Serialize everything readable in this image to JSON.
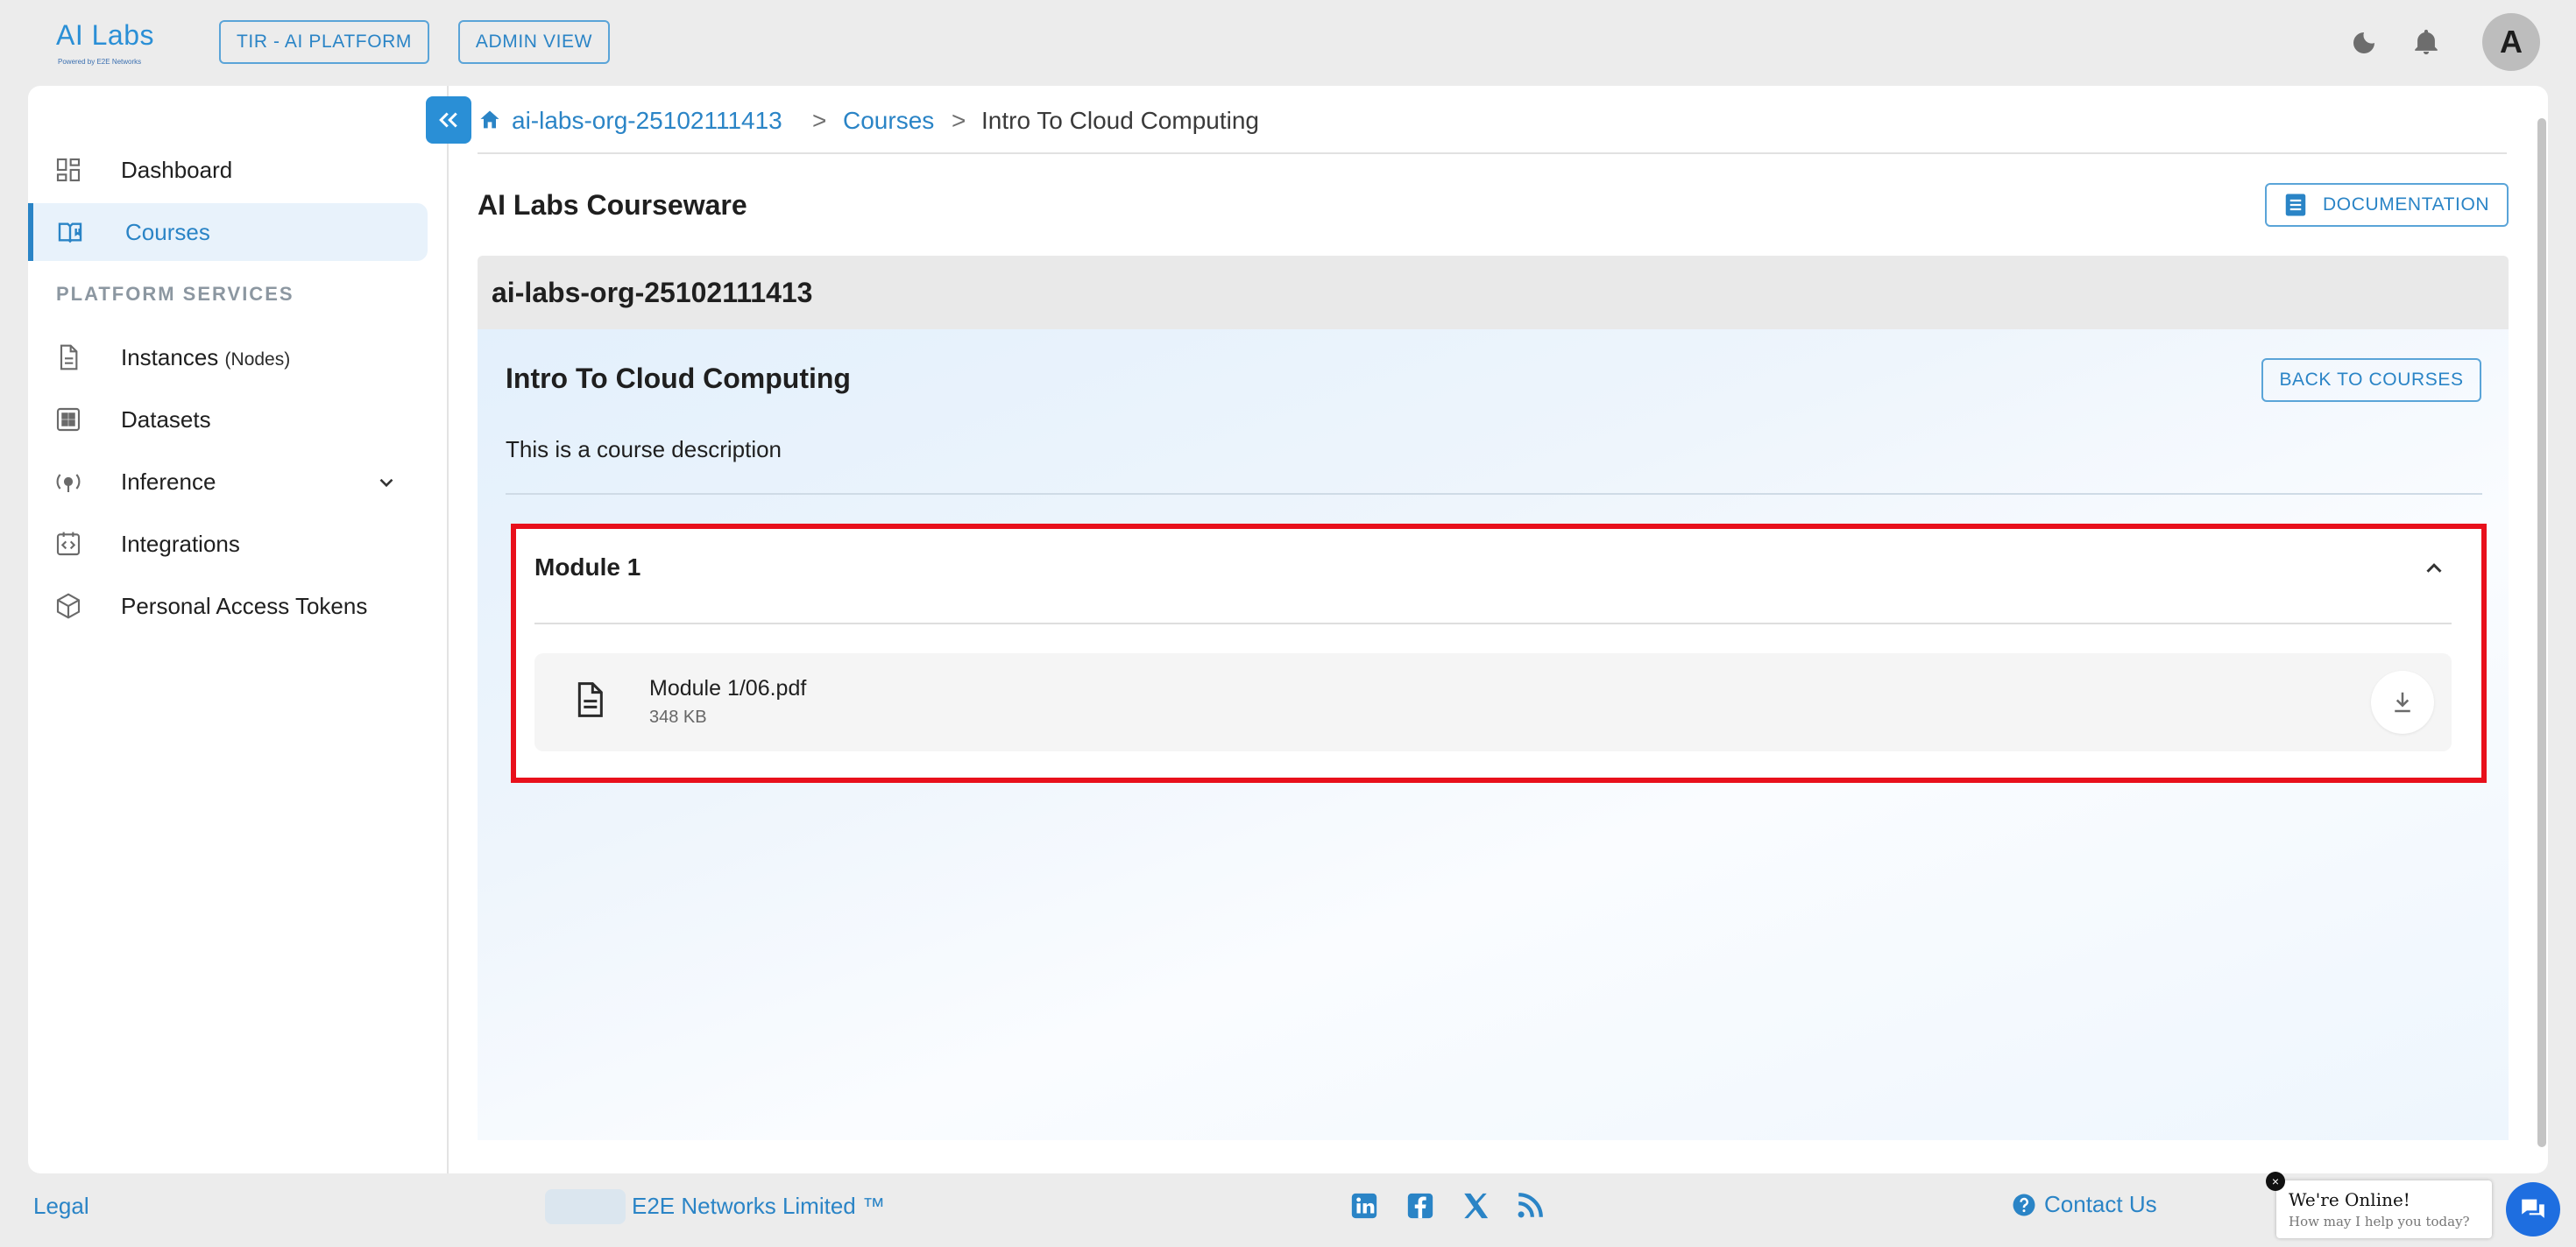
{
  "brand": {
    "logo_text": "AI Labs",
    "logo_tagline": "Powered by E2E Networks"
  },
  "header": {
    "platform_button": "TIR - AI PLATFORM",
    "admin_button": "ADMIN VIEW",
    "avatar_letter": "A",
    "icons": [
      "moon-icon",
      "bell-icon"
    ]
  },
  "sidebar": {
    "items": [
      {
        "label": "Dashboard",
        "icon": "dashboard-icon"
      },
      {
        "label": "Courses",
        "icon": "book-icon",
        "active": true
      }
    ],
    "section_title": "PLATFORM SERVICES",
    "services": [
      {
        "label": "Instances",
        "suffix": "(Nodes)",
        "icon": "document-icon"
      },
      {
        "label": "Datasets",
        "icon": "grid-icon"
      },
      {
        "label": "Inference",
        "icon": "inference-icon",
        "expandable": true
      },
      {
        "label": "Integrations",
        "icon": "code-icon"
      },
      {
        "label": "Personal Access Tokens",
        "icon": "token-icon"
      }
    ]
  },
  "breadcrumb": {
    "org": "ai-labs-org-25102111413",
    "separator": ">",
    "section": "Courses",
    "current": "Intro To Cloud Computing"
  },
  "main": {
    "title": "AI Labs Courseware",
    "documentation_button": "DOCUMENTATION",
    "org_header": "ai-labs-org-25102111413",
    "course": {
      "title": "Intro To Cloud Computing",
      "back_button": "BACK TO COURSES",
      "description": "This is a course description",
      "modules": [
        {
          "title": "Module 1",
          "expanded": true,
          "files": [
            {
              "name": "Module 1/06.pdf",
              "size": "348 KB"
            }
          ]
        }
      ]
    }
  },
  "footer": {
    "legal": "Legal",
    "company": "E2E Networks Limited ™",
    "social": [
      "linkedin-icon",
      "facebook-icon",
      "x-icon",
      "rss-icon"
    ],
    "contact": "Contact Us"
  },
  "chat": {
    "title": "We're Online!",
    "subtitle": "How may I help you today?",
    "close": "×"
  },
  "colors": {
    "accent": "#2a84c6",
    "highlight_border": "#e8101c",
    "card_header": "#e9e9e9",
    "sidebar_active_bg": "#e8f2fb"
  }
}
